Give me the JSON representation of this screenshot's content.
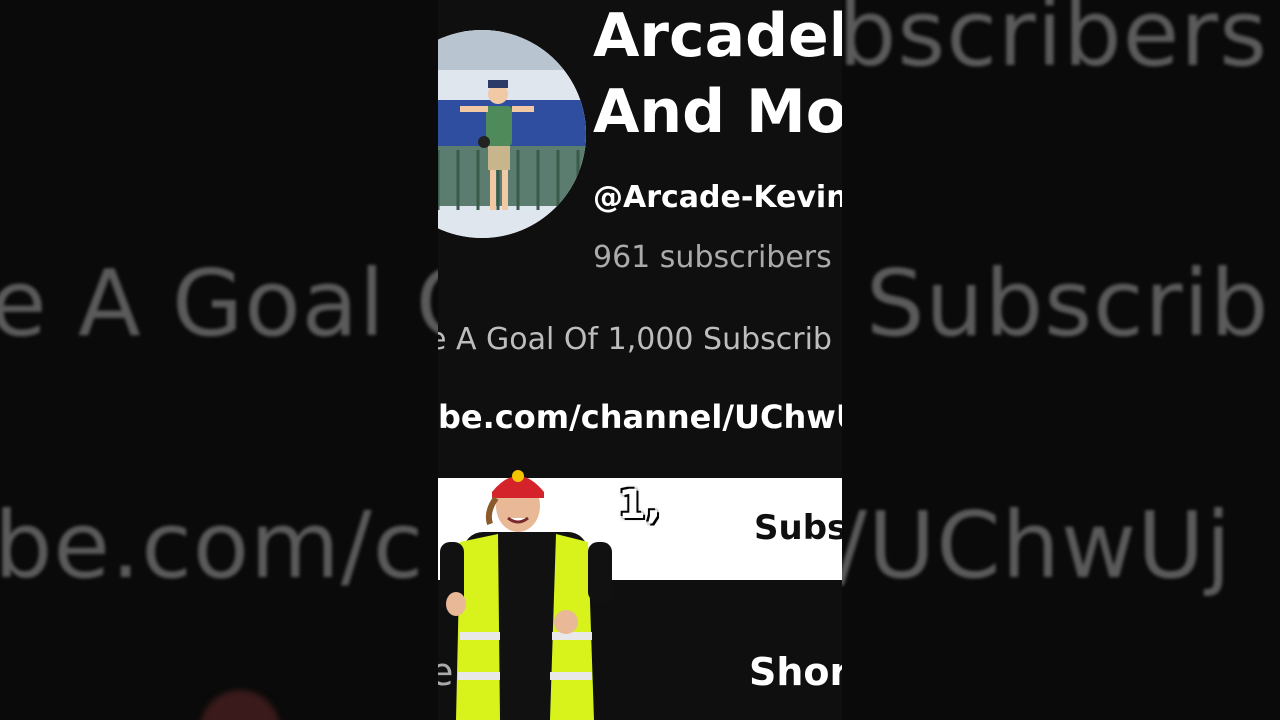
{
  "background": {
    "right_top_text": "bscribers",
    "left_mid_text": "e A Goal O",
    "right_mid_text": "Subscrib",
    "left_low_text": "be.com/c",
    "right_low_text": "/UChwUj"
  },
  "channel": {
    "title_line1": "Arcadek",
    "title_line2": "And Mor",
    "handle": "@Arcade-Kevin",
    "subscribers": "961 subscribers",
    "description": "e A Goal Of 1,000 Subscrib",
    "link": "be.com/channel/UChwUj"
  },
  "subscribe": {
    "label": "Subs"
  },
  "overlay": {
    "counter_text": "1,"
  },
  "tabs": [
    {
      "label": "e   ideos"
    },
    {
      "label": "Shor"
    }
  ],
  "colors": {
    "page_bg": "#0f0f0f",
    "subscribe_bg": "#ffffff",
    "vest": "#d8f21c"
  }
}
